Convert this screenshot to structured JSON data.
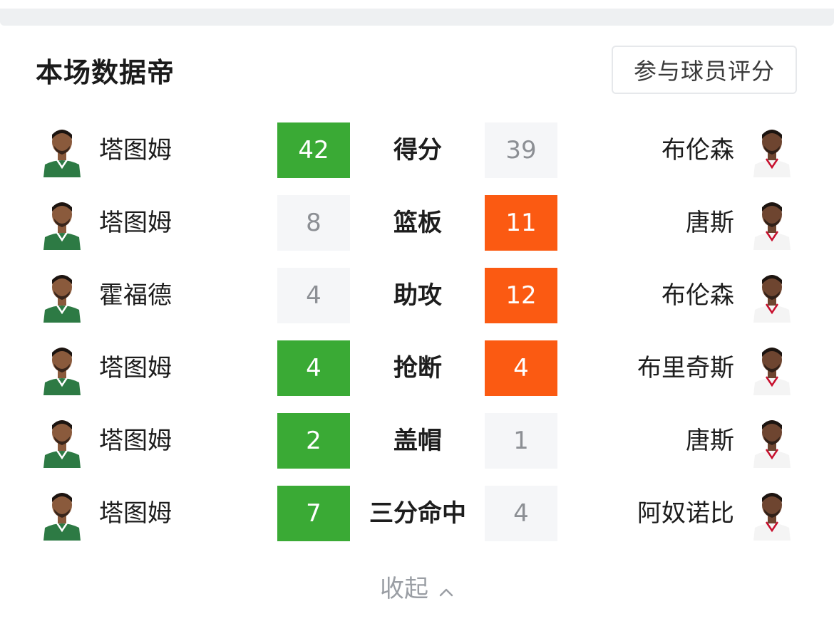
{
  "header": {
    "title": "本场数据帝",
    "rate_button_label": "参与球员评分"
  },
  "colors": {
    "home_win": "#3aaa35",
    "away_win": "#fb5a12",
    "neutral_bg": "#f5f6f8",
    "neutral_text": "#8c8f94"
  },
  "rows": [
    {
      "category": "得分",
      "left_player": "塔图姆",
      "left_value": "42",
      "right_value": "39",
      "right_player": "布伦森",
      "leader": "left"
    },
    {
      "category": "篮板",
      "left_player": "塔图姆",
      "left_value": "8",
      "right_value": "11",
      "right_player": "唐斯",
      "leader": "right"
    },
    {
      "category": "助攻",
      "left_player": "霍福德",
      "left_value": "4",
      "right_value": "12",
      "right_player": "布伦森",
      "leader": "right"
    },
    {
      "category": "抢断",
      "left_player": "塔图姆",
      "left_value": "4",
      "right_value": "4",
      "right_player": "布里奇斯",
      "leader": "both"
    },
    {
      "category": "盖帽",
      "left_player": "塔图姆",
      "left_value": "2",
      "right_value": "1",
      "right_player": "唐斯",
      "leader": "left"
    },
    {
      "category": "三分命中",
      "left_player": "塔图姆",
      "left_value": "7",
      "right_value": "4",
      "right_player": "阿奴诺比",
      "leader": "left"
    }
  ],
  "footer": {
    "collapse_label": "收起",
    "collapse_icon": "chevron-up-icon"
  }
}
